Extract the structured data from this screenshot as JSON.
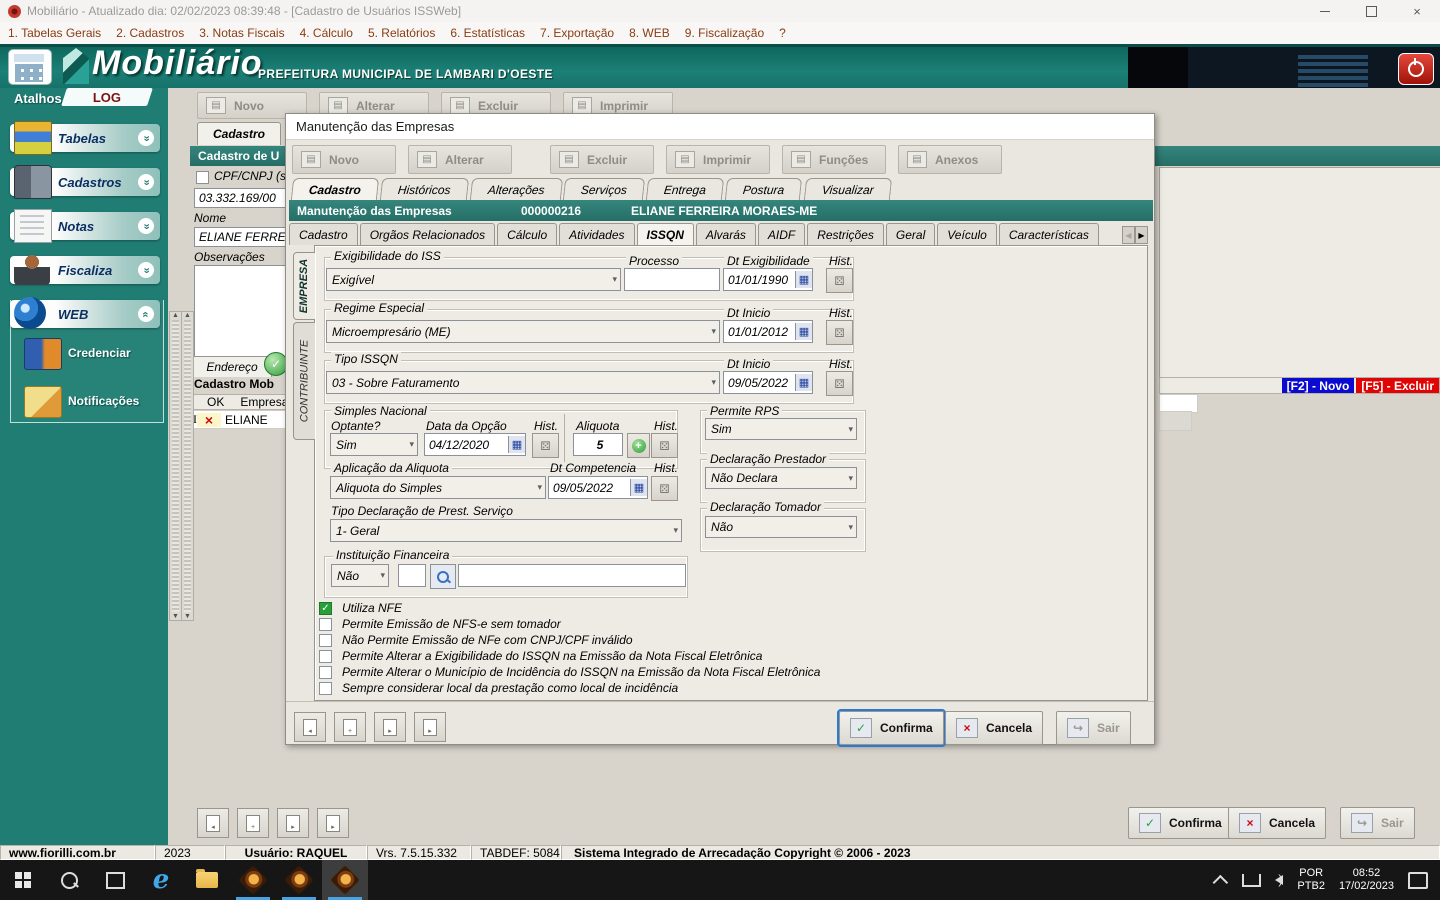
{
  "window": {
    "title": "Mobiliário - Atualizado dia: 02/02/2023 08:39:48 - [Cadastro de Usuários ISSWeb]"
  },
  "menubar": {
    "items": [
      {
        "label": "1. Tabelas Gerais"
      },
      {
        "label": "2. Cadastros"
      },
      {
        "label": "3. Notas Fiscais"
      },
      {
        "label": "4. Cálculo"
      },
      {
        "label": "5. Relatórios"
      },
      {
        "label": "6. Estatísticas"
      },
      {
        "label": "7. Exportação"
      },
      {
        "label": "8. WEB"
      },
      {
        "label": "9. Fiscalização"
      },
      {
        "label": "?"
      }
    ]
  },
  "header": {
    "app_name": "Mobiliário",
    "subtitle": "PREFEITURA MUNICIPAL DE LAMBARI D'OESTE"
  },
  "sidebar": {
    "atalhos_label": "Atalhos",
    "log_label": "LOG",
    "groups": [
      {
        "label": "Tabelas",
        "icon": "icon-tabelas"
      },
      {
        "label": "Cadastros",
        "icon": "icon-cadastros"
      },
      {
        "label": "Notas",
        "icon": "icon-notas"
      },
      {
        "label": "Fiscaliza",
        "icon": "icon-fiscaliza"
      }
    ],
    "web_group_label": "WEB",
    "web_items": [
      {
        "label": "Credenciar",
        "icon": "icon-credenciar"
      },
      {
        "label": "Notificações",
        "icon": "icon-notificacoes"
      }
    ]
  },
  "back_window": {
    "toolbar": [
      {
        "label": "Novo"
      },
      {
        "label": "Alterar"
      },
      {
        "label": "Excluir"
      },
      {
        "label": "Imprimir"
      }
    ],
    "tab_label": "Cadastro",
    "section_title": "Cadastro de U",
    "cpf_label": "CPF/CNPJ (s",
    "cpf_value": "03.332.169/00",
    "nome_label": "Nome",
    "nome_value": "ELIANE FERREI",
    "obs_label": "Observações",
    "endereco_tab": "Endereço",
    "grid_title": "Cadastro Mob",
    "grid_col_ok": "OK",
    "grid_col_empresa": "Empresa",
    "grid_row_cursor": "I",
    "grid_row_name": "ELIANE",
    "f2_label": "[F2] - Novo",
    "f5_label": "[F5] - Excluir",
    "confirma": "Confirma",
    "cancela": "Cancela",
    "sair": "Sair"
  },
  "dialog": {
    "title": "Manutenção das Empresas",
    "toolbar": [
      {
        "label": "Novo"
      },
      {
        "label": "Alterar"
      },
      {
        "label": "Excluir"
      },
      {
        "label": "Imprimir"
      },
      {
        "label": "Funções"
      },
      {
        "label": "Anexos"
      }
    ],
    "outer_tabs": [
      {
        "label": "Cadastro",
        "active": true
      },
      {
        "label": "Históricos"
      },
      {
        "label": "Alterações"
      },
      {
        "label": "Serviços"
      },
      {
        "label": "Entrega"
      },
      {
        "label": "Postura"
      },
      {
        "label": "Visualizar"
      }
    ],
    "record_bar": {
      "title": "Manutenção das Empresas",
      "code": "000000216",
      "name": "ELIANE FERREIRA MORAES-ME"
    },
    "inner_tabs": [
      {
        "label": "Cadastro"
      },
      {
        "label": "Orgãos Relacionados"
      },
      {
        "label": "Cálculo"
      },
      {
        "label": "Atividades"
      },
      {
        "label": "ISSQN",
        "active": true
      },
      {
        "label": "Alvarás"
      },
      {
        "label": "AIDF"
      },
      {
        "label": "Restrições"
      },
      {
        "label": "Geral"
      },
      {
        "label": "Veículo"
      },
      {
        "label": "Características"
      }
    ],
    "side_tab_empresa": "EMPRESA",
    "side_tab_contribuinte": "CONTRIBUINTE",
    "form": {
      "exigibilidade_label": "Exigibilidade do ISS",
      "exigibilidade_value": "Exigível",
      "processo_label": "Processo",
      "processo_value": "",
      "dt_exigibilidade_label": "Dt Exigibilidade",
      "dt_exigibilidade_value": "01/01/1990",
      "hist_label": "Hist.",
      "regime_label": "Regime Especial",
      "regime_value": "Microempresário (ME)",
      "dt_inicio_label": "Dt Inicio",
      "regime_dt_value": "01/01/2012",
      "tipo_issqn_label": "Tipo ISSQN",
      "tipo_issqn_value": "03 - Sobre Faturamento",
      "tipo_issqn_dt_value": "09/05/2022",
      "simples_label": "Simples Nacional",
      "optante_label": "Optante?",
      "optante_value": "Sim",
      "data_opcao_label": "Data da Opção",
      "data_opcao_value": "04/12/2020",
      "aliquota_label": "Aliquota",
      "aliquota_value": "5",
      "aplicacao_label": "Aplicação da Aliquota",
      "aplicacao_value": "Aliquota do Simples",
      "dt_competencia_label": "Dt Competencia",
      "dt_competencia_value": "09/05/2022",
      "tipo_decl_label": "Tipo Declaração de Prest. Serviço",
      "tipo_decl_value": "1- Geral",
      "permite_rps_label": "Permite RPS",
      "permite_rps_value": "Sim",
      "decl_prestador_label": "Declaração Prestador",
      "decl_prestador_value": "Não Declara",
      "decl_tomador_label": "Declaração Tomador",
      "decl_tomador_value": "Não",
      "inst_fin_label": "Instituição Financeira",
      "inst_fin_value": "Não",
      "checkboxes": [
        {
          "label": "Utiliza NFE",
          "checked": true
        },
        {
          "label": "Permite Emissão de NFS-e sem tomador",
          "checked": false
        },
        {
          "label": "Não Permite Emissão de NFe com CNPJ/CPF inválido",
          "checked": false
        },
        {
          "label": "Permite Alterar a Exigibilidade do ISSQN na Emissão da Nota Fiscal Eletrônica",
          "checked": false
        },
        {
          "label": "Permite Alterar o Município de Incidência do ISSQN na Emissão da Nota Fiscal Eletrônica",
          "checked": false
        },
        {
          "label": "Sempre considerar local da prestação como local de incidência",
          "checked": false
        }
      ]
    },
    "footer": {
      "confirma": "Confirma",
      "cancela": "Cancela",
      "sair": "Sair"
    }
  },
  "statusbar": {
    "site": "www.fiorilli.com.br",
    "year": "2023",
    "user": "Usuário: RAQUEL",
    "version": "Vrs. 7.5.15.332",
    "tabdef": "TABDEF: 5084",
    "copyright": "Sistema Integrado de Arrecadação Copyright © 2006 - 2023"
  },
  "taskbar": {
    "lang_top": "POR",
    "lang_bottom": "PTB2",
    "time": "08:52",
    "date": "17/02/2023"
  },
  "colors": {
    "teal": "#1f7d73",
    "teal_bar": "#2b7e75",
    "f2_blue": "#0a0ad0",
    "f5_red": "#e00404"
  }
}
